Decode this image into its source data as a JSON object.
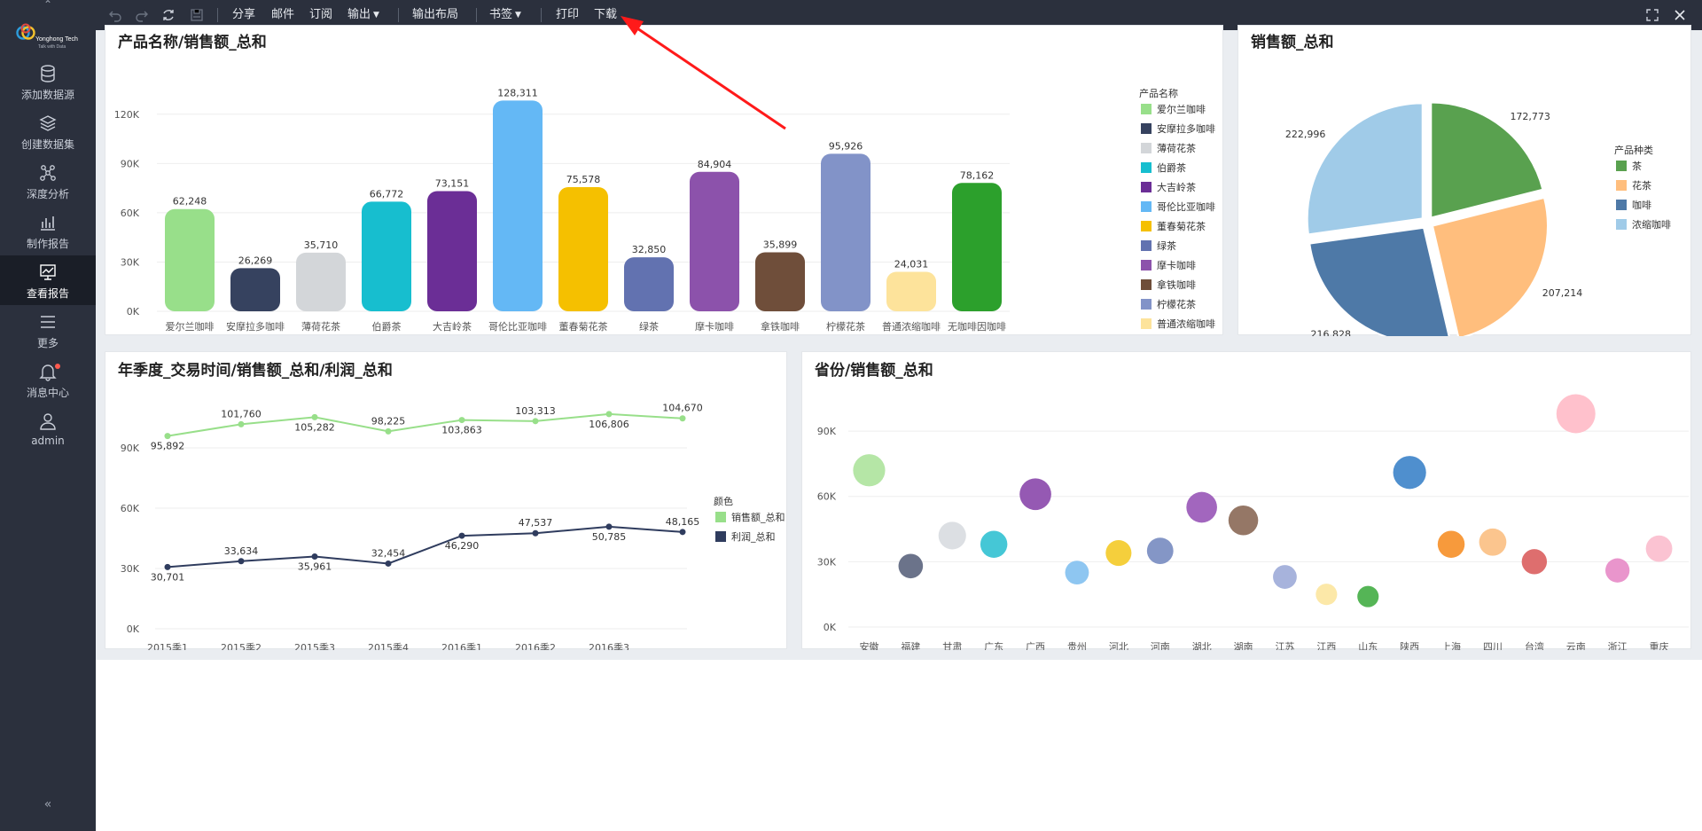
{
  "sidebar": {
    "logo_line1": "Yonghong Tech",
    "logo_line2": "Talk with Data",
    "items": [
      {
        "label": "添加数据源",
        "icon": "database-icon"
      },
      {
        "label": "创建数据集",
        "icon": "layers-icon"
      },
      {
        "label": "深度分析",
        "icon": "network-icon"
      },
      {
        "label": "制作报告",
        "icon": "bar-chart-icon"
      },
      {
        "label": "查看报告",
        "icon": "monitor-chart-icon",
        "active": true
      },
      {
        "label": "更多",
        "icon": "menu-icon"
      },
      {
        "label": "消息中心",
        "icon": "bell-icon",
        "has_badge": true
      },
      {
        "label": "admin",
        "icon": "user-icon"
      }
    ],
    "collapse_glyph": "«"
  },
  "toolbar": {
    "share": "分享",
    "mail": "邮件",
    "subscribe": "订阅",
    "export": "输出",
    "export_layout": "输出布局",
    "bookmark": "书签",
    "print": "打印",
    "download": "下载"
  },
  "colors": {
    "sidebar_bg": "#2b303d",
    "annotation_arrow": "#ff1a1a",
    "sales_line": "#98df8a",
    "profit_line": "#2f3c5e"
  },
  "panels": {
    "bar_title": "产品名称/销售额_总和",
    "pie_title": "销售额_总和",
    "line_title": "年季度_交易时间/销售额_总和/利润_总和",
    "bubble_title": "省份/销售额_总和"
  },
  "chart_data": [
    {
      "type": "bar",
      "title": "产品名称/销售额_总和",
      "legend_title": "产品名称",
      "legend_position": "right",
      "categories": [
        "爱尔兰咖啡",
        "安摩拉多咖啡",
        "薄荷花茶",
        "伯爵茶",
        "大吉岭茶",
        "哥伦比亚咖啡",
        "董春菊花茶",
        "绿茶",
        "摩卡咖啡",
        "拿铁咖啡",
        "柠檬花茶",
        "普通浓缩咖啡",
        "无咖啡因咖啡"
      ],
      "values": [
        62248,
        26269,
        35710,
        66772,
        73151,
        128311,
        75578,
        32850,
        84904,
        35899,
        95926,
        24031,
        78162
      ],
      "labels": [
        "62,248",
        "26,269",
        "35,710",
        "66,772",
        "73,151",
        "128,311",
        "75,578",
        "32,850",
        "84,904",
        "35,899",
        "95,926",
        "24,031",
        "78,162"
      ],
      "colors": [
        "#98df8a",
        "#36425f",
        "#d3d6d9",
        "#17becf",
        "#6b2e96",
        "#64b8f5",
        "#f5c000",
        "#6272b0",
        "#8c52ab",
        "#6f4e3a",
        "#8293c8",
        "#fde39b",
        "#2ca02c"
      ],
      "yticks": [
        "0K",
        "30K",
        "60K",
        "90K",
        "120K"
      ],
      "ylim": [
        0,
        135000
      ],
      "grid": true
    },
    {
      "type": "pie",
      "title": "销售额_总和",
      "legend_title": "产品种类",
      "legend_position": "right",
      "slices": [
        {
          "name": "茶",
          "value": 172773,
          "label": "172,773",
          "color": "#59a14f"
        },
        {
          "name": "花茶",
          "value": 207214,
          "label": "207,214",
          "color": "#ffbe7d"
        },
        {
          "name": "咖啡",
          "value": 216828,
          "label": "216,828",
          "color": "#4e79a7"
        },
        {
          "name": "浓缩咖啡",
          "value": 222996,
          "label": "222,996",
          "color": "#a0cbe8"
        }
      ]
    },
    {
      "type": "line",
      "title": "年季度_交易时间/销售额_总和/利润_总和",
      "legend_title": "颜色",
      "legend_position": "right",
      "categories": [
        "2015季1",
        "2015季2",
        "2015季3",
        "2015季4",
        "2016季1",
        "2016季2",
        "2016季3"
      ],
      "x_extra_points": 1,
      "series": [
        {
          "name": "销售额_总和",
          "color": "#98df8a",
          "values": [
            95892,
            101760,
            105282,
            98225,
            103863,
            103313,
            106806,
            104670
          ],
          "labels": [
            "95,892",
            "101,760",
            "105,282",
            "98,225",
            "103,863",
            "103,313",
            "106,806",
            "104,670"
          ]
        },
        {
          "name": "利润_总和",
          "color": "#2f3c5e",
          "values": [
            30701,
            33634,
            35961,
            32454,
            46290,
            47537,
            50785,
            48165
          ],
          "labels": [
            "30,701",
            "33,634",
            "35,961",
            "32,454",
            "46,290",
            "47,537",
            "50,785",
            "48,165"
          ]
        }
      ],
      "yticks": [
        "0K",
        "30K",
        "60K",
        "90K"
      ],
      "grid": true
    },
    {
      "type": "scatter",
      "title": "省份/销售额_总和",
      "categories": [
        "安徽",
        "福建",
        "甘肃",
        "广东",
        "广西",
        "贵州",
        "河北",
        "河南",
        "湖北",
        "湖南",
        "江苏",
        "江西",
        "山东",
        "陕西",
        "上海",
        "四川",
        "台湾",
        "云南",
        "浙江",
        "重庆"
      ],
      "values": [
        72000,
        28000,
        42000,
        38000,
        61000,
        25000,
        34000,
        35000,
        55000,
        49000,
        23000,
        15000,
        14000,
        71000,
        38000,
        39000,
        30000,
        98000,
        26000,
        36000
      ],
      "sizes": [
        120000,
        50000,
        75000,
        70000,
        115000,
        45000,
        60000,
        65000,
        105000,
        95000,
        45000,
        30000,
        30000,
        130000,
        70000,
        72000,
        55000,
        210000,
        48000,
        65000
      ],
      "colors": [
        "#b5e6a6",
        "#6b738a",
        "#dcdfe3",
        "#45c7d6",
        "#9559b3",
        "#8ec6f1",
        "#f5cf3c",
        "#8496c6",
        "#a266be",
        "#957766",
        "#a7b3dc",
        "#fce8a8",
        "#55b556",
        "#4f8fce",
        "#f79a3c",
        "#fbc58e",
        "#de6e6e",
        "#ffc1cc",
        "#e995cc",
        "#fbc3d2"
      ],
      "yticks": [
        "0K",
        "30K",
        "60K",
        "90K"
      ],
      "ylim": [
        0,
        110000
      ],
      "grid": true
    }
  ]
}
